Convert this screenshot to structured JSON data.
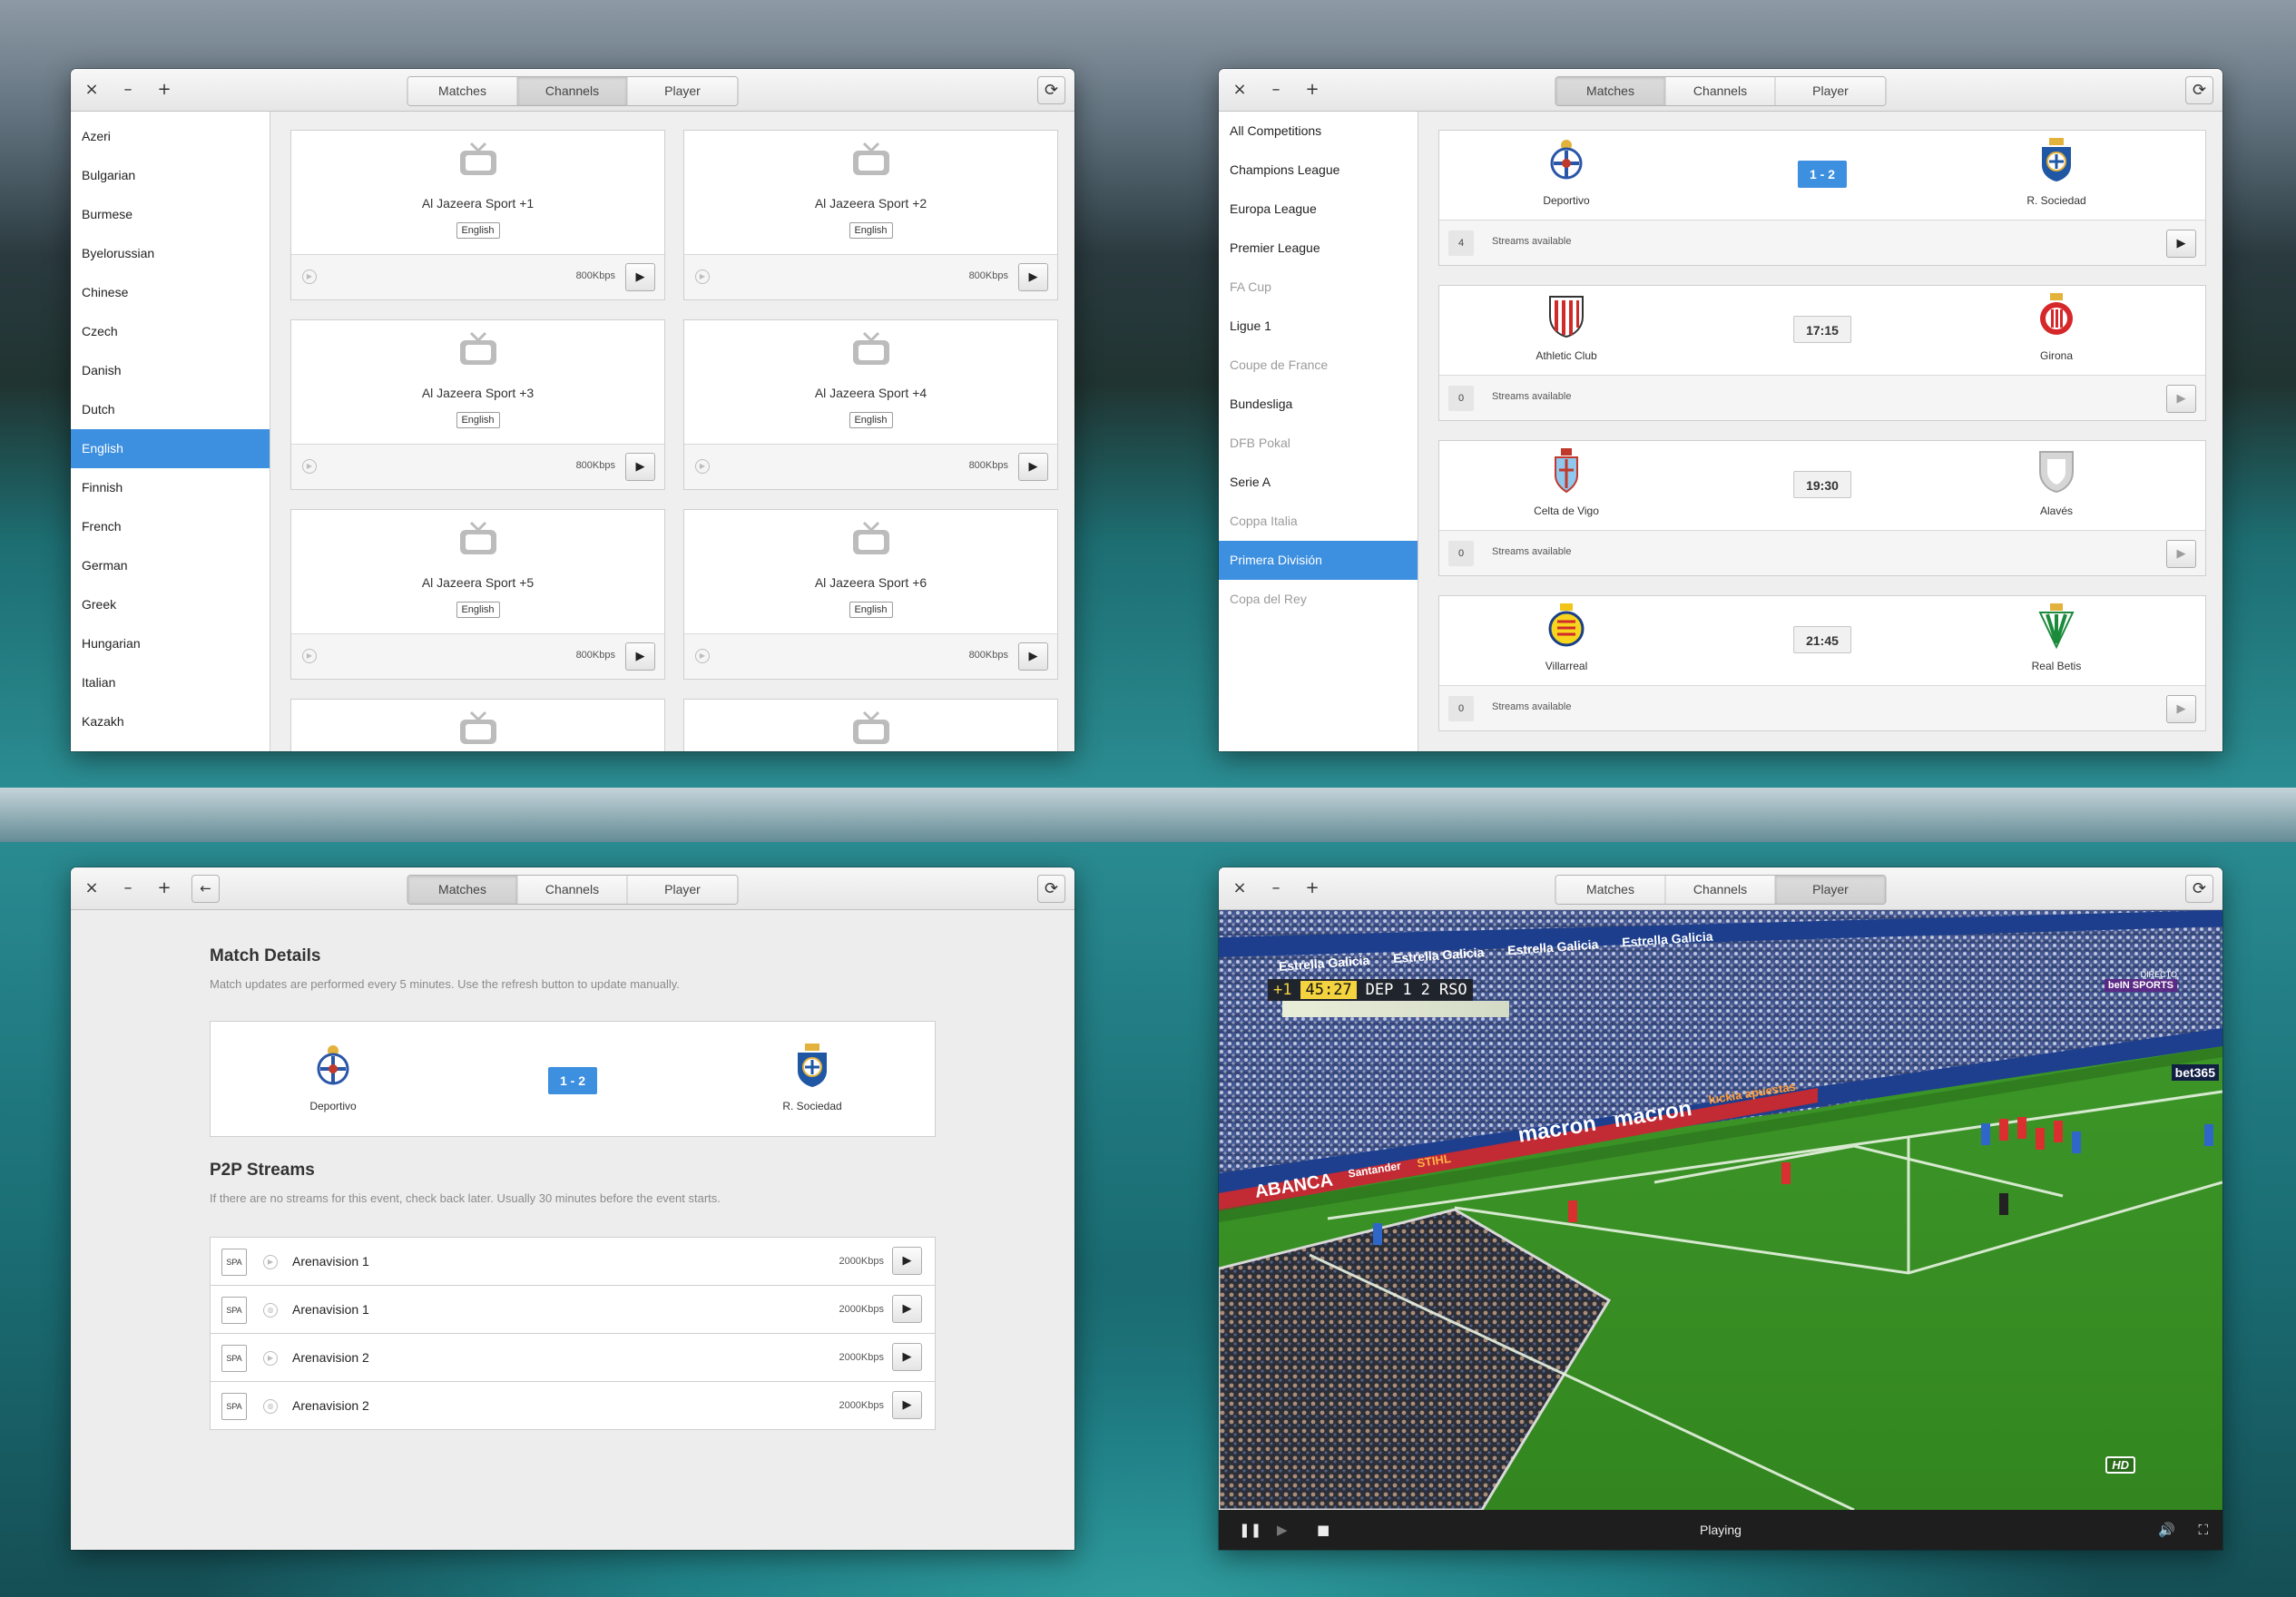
{
  "window": {
    "close_glyph": "×",
    "minimize_glyph": "–",
    "maximize_glyph": "+",
    "tabs": [
      "Matches",
      "Channels",
      "Player"
    ],
    "refresh_icon": "refresh-icon",
    "back_icon": "back-arrow-icon"
  },
  "channels_window": {
    "languages": [
      "Azeri",
      "Bulgarian",
      "Burmese",
      "Byelorussian",
      "Chinese",
      "Czech",
      "Danish",
      "Dutch",
      "English",
      "Finnish",
      "French",
      "German",
      "Greek",
      "Hungarian",
      "Italian",
      "Kazakh"
    ],
    "selected_language": "English",
    "channels": [
      {
        "name": "Al Jazeera Sport +1",
        "lang": "English",
        "bitrate": "800Kbps"
      },
      {
        "name": "Al Jazeera Sport +2",
        "lang": "English",
        "bitrate": "800Kbps"
      },
      {
        "name": "Al Jazeera Sport +3",
        "lang": "English",
        "bitrate": "800Kbps"
      },
      {
        "name": "Al Jazeera Sport +4",
        "lang": "English",
        "bitrate": "800Kbps"
      },
      {
        "name": "Al Jazeera Sport +5",
        "lang": "English",
        "bitrate": "800Kbps"
      },
      {
        "name": "Al Jazeera Sport +6",
        "lang": "English",
        "bitrate": "800Kbps"
      }
    ]
  },
  "matches_window": {
    "competitions": [
      {
        "name": "All Competitions",
        "enabled": true
      },
      {
        "name": "Champions League",
        "enabled": true
      },
      {
        "name": "Europa League",
        "enabled": true
      },
      {
        "name": "Premier League",
        "enabled": true
      },
      {
        "name": "FA Cup",
        "enabled": false
      },
      {
        "name": "Ligue 1",
        "enabled": true
      },
      {
        "name": "Coupe de France",
        "enabled": false
      },
      {
        "name": "Bundesliga",
        "enabled": true
      },
      {
        "name": "DFB Pokal",
        "enabled": false
      },
      {
        "name": "Serie A",
        "enabled": true
      },
      {
        "name": "Coppa Italia",
        "enabled": false
      },
      {
        "name": "Primera División",
        "enabled": true
      },
      {
        "name": "Copa del Rey",
        "enabled": false
      }
    ],
    "selected_competition": "Primera División",
    "streams_label": "Streams available",
    "matches": [
      {
        "home": "Deportivo",
        "away": "R. Sociedad",
        "score": "1 - 2",
        "live": true,
        "streams": "4"
      },
      {
        "home": "Athletic Club",
        "away": "Girona",
        "score": "17:15",
        "live": false,
        "streams": "0"
      },
      {
        "home": "Celta de Vigo",
        "away": "Alavés",
        "score": "19:30",
        "live": false,
        "streams": "0"
      },
      {
        "home": "Villarreal",
        "away": "Real Betis",
        "score": "21:45",
        "live": false,
        "streams": "0"
      }
    ]
  },
  "details_window": {
    "title": "Match Details",
    "subtitle": "Match updates are performed every 5 minutes. Use the refresh button to update manually.",
    "home": "Deportivo",
    "away": "R. Sociedad",
    "score": "1 - 2",
    "streams_title": "P2P Streams",
    "streams_subtitle": "If there are no streams for this event, check back later. Usually 30 minutes before the event starts.",
    "streams": [
      {
        "lang": "SPA",
        "name": "Arenavision 1",
        "bitrate": "2000Kbps",
        "icon": "play-circle-icon"
      },
      {
        "lang": "SPA",
        "name": "Arenavision 1",
        "bitrate": "2000Kbps",
        "icon": "globe-icon"
      },
      {
        "lang": "SPA",
        "name": "Arenavision 2",
        "bitrate": "2000Kbps",
        "icon": "play-circle-icon"
      },
      {
        "lang": "SPA",
        "name": "Arenavision 2",
        "bitrate": "2000Kbps",
        "icon": "globe-icon"
      }
    ]
  },
  "player_window": {
    "status": "Playing",
    "scoreboard": {
      "extra": "+1",
      "clock": "45:27",
      "home": "DEP",
      "home_score": "1",
      "away_score": "2",
      "away": "RSO"
    },
    "broadcaster": "beIN SPORTS",
    "broadcaster_tag": "DIRECTO",
    "hd_badge": "HD",
    "ad_banners": [
      "Estrella Galicia",
      "Estrella Galicia",
      "Estrella Galicia",
      "Estrella Galicia",
      "macron",
      "macron",
      "luckia apuestas",
      "ABANCA",
      "Santander",
      "STIHL",
      "bet365"
    ]
  },
  "colors": {
    "accent": "#3d8fe0",
    "titlebar": "#ebebeb",
    "content_bg": "#efefef",
    "pitch": "#3f9a2a"
  }
}
